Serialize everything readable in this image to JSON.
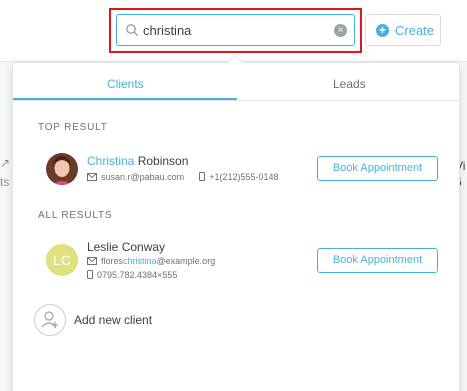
{
  "search": {
    "value": "christina",
    "clear_icon": "clear-icon",
    "search_icon": "search-icon"
  },
  "header": {
    "create_label": "Create",
    "create_icon": "plus-circle-icon"
  },
  "background": {
    "left_fragment": "ts",
    "right_fragment": "Vi\n6"
  },
  "dropdown": {
    "tabs": [
      {
        "label": "Clients",
        "active": true
      },
      {
        "label": "Leads",
        "active": false
      }
    ],
    "top_result_label": "TOP RESULT",
    "all_results_label": "ALL RESULTS",
    "top_result": {
      "name_highlight": "Christina",
      "name_rest": " Robinson",
      "email": "susan.r@pabau.com",
      "phone": "+1(212)555-0148",
      "button": "Book Appointment"
    },
    "all_results": [
      {
        "initials": "LC",
        "name": "Leslie Conway",
        "email_pre": "flores",
        "email_highlight": "christina",
        "email_post": "@example.org",
        "phone": "0795.782.4384×555",
        "button": "Book Appointment"
      }
    ],
    "add_new_label": "Add new client"
  },
  "colors": {
    "accent": "#46b2dc",
    "highlight_box": "#e0161d",
    "avatar_lc": "#dfe07e"
  }
}
